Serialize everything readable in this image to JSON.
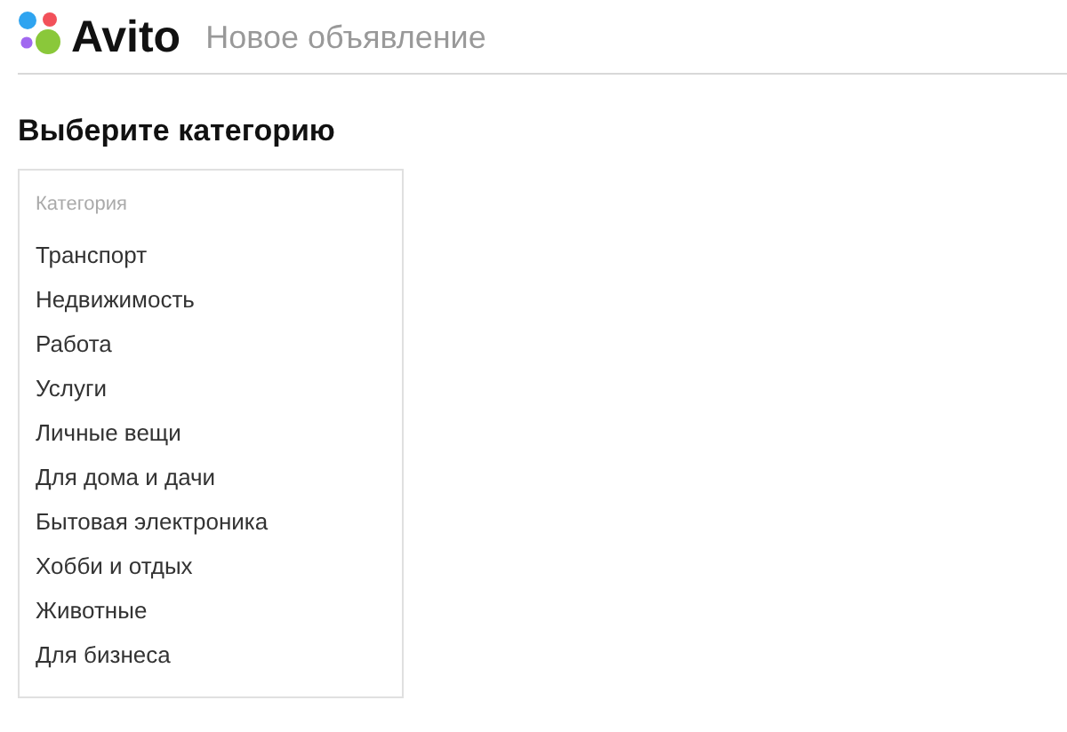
{
  "header": {
    "logo_text": "Avito",
    "subtitle": "Новое объявление"
  },
  "heading": "Выберите категорию",
  "category_list": {
    "label": "Категория",
    "items": [
      {
        "label": "Транспорт"
      },
      {
        "label": "Недвижимость"
      },
      {
        "label": "Работа"
      },
      {
        "label": "Услуги"
      },
      {
        "label": "Личные вещи"
      },
      {
        "label": "Для дома и дачи"
      },
      {
        "label": "Бытовая электроника"
      },
      {
        "label": "Хобби и отдых"
      },
      {
        "label": "Животные"
      },
      {
        "label": "Для бизнеса"
      }
    ]
  }
}
